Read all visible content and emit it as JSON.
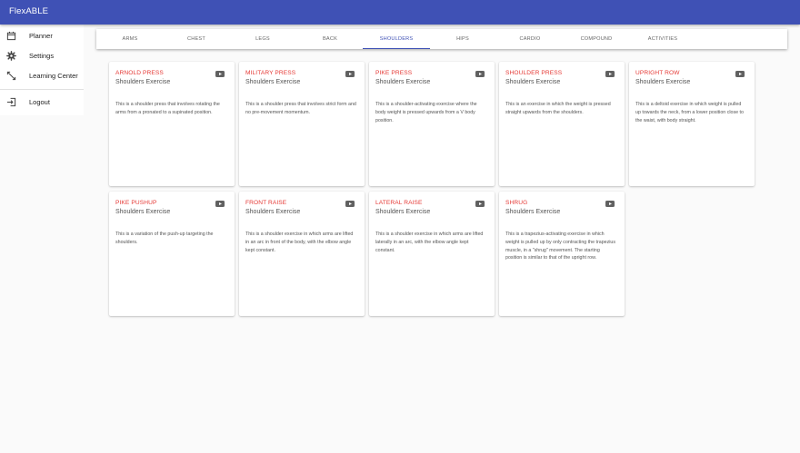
{
  "app": {
    "title": "FlexABLE",
    "accent": "#3f51b5",
    "title_color": "#e53935"
  },
  "sidebar": {
    "items": [
      {
        "label": "Planner",
        "icon": "calendar-icon"
      },
      {
        "label": "Settings",
        "icon": "gear-icon"
      },
      {
        "label": "Learning Center",
        "icon": "expand-arrows-icon"
      },
      {
        "label": "Logout",
        "icon": "logout-icon"
      }
    ]
  },
  "tabs": {
    "items": [
      "ARMS",
      "CHEST",
      "LEGS",
      "BACK",
      "SHOULDERS",
      "HIPS",
      "CARDIO",
      "COMPOUND",
      "ACTIVITIES"
    ],
    "active": "SHOULDERS"
  },
  "cards": [
    {
      "title": "ARNOLD PRESS",
      "subtitle": "Shoulders Exercise",
      "description": "This is a shoulder press that involves rotating the arms from a pronated to a supinated position.",
      "icon": "youtube-icon"
    },
    {
      "title": "MILITARY PRESS",
      "subtitle": "Shoulders Exercise",
      "description": "This is a shoulder press that involves strict form and no pre-movement momentum.",
      "icon": "youtube-icon"
    },
    {
      "title": "PIKE PRESS",
      "subtitle": "Shoulders Exercise",
      "description": "This is a shoulder-activating exercise where the body weight is pressed upwards from a V body position.",
      "icon": "youtube-icon"
    },
    {
      "title": "SHOULDER PRESS",
      "subtitle": "Shoulders Exercise",
      "description": "This is an exercise in which the weight is pressed straight upwards from the shoulders.",
      "icon": "youtube-icon"
    },
    {
      "title": "UPRIGHT ROW",
      "subtitle": "Shoulders Exercise",
      "description": "This is a deltoid exercise in which weight is pulled up towards the neck, from a lower position close to the waist, with body straight.",
      "icon": "youtube-icon"
    },
    {
      "title": "PIKE PUSHUP",
      "subtitle": "Shoulders Exercise",
      "description": "This is a variation of the push-up targeting the shoulders.",
      "icon": "youtube-icon"
    },
    {
      "title": "FRONT RAISE",
      "subtitle": "Shoulders Exercise",
      "description": "This is a shoulder exercise in which arms are lifted in an arc in front of the body, with the elbow angle kept constant.",
      "icon": "youtube-icon"
    },
    {
      "title": "LATERAL RAISE",
      "subtitle": "Shoulders Exercise",
      "description": "This is a shoulder exercise in which arms are lifted laterally in an arc, with the elbow angle kept constant.",
      "icon": "youtube-icon"
    },
    {
      "title": "SHRUG",
      "subtitle": "Shoulders Exercise",
      "description": "This is a trapezius-activating exercise in which weight is pulled up by only contracting the trapezius muscle, in a \"shrug\" movement. The starting position is similar to that of the upright row.",
      "icon": "youtube-icon"
    }
  ]
}
